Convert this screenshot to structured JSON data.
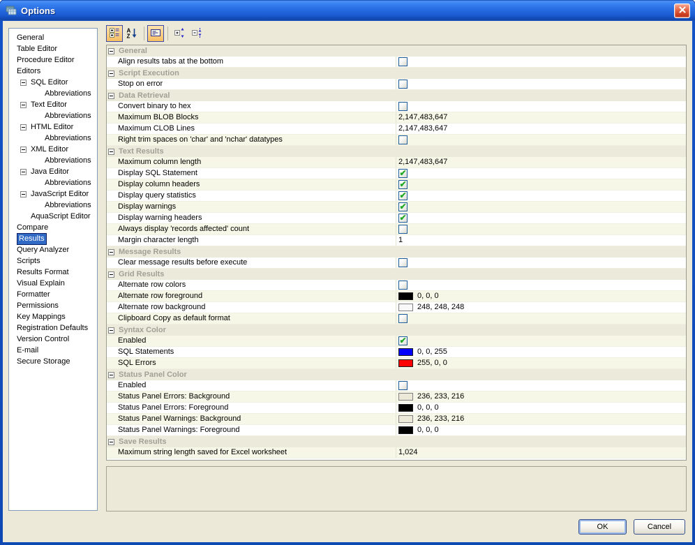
{
  "window": {
    "title": "Options"
  },
  "buttons": {
    "ok": "OK",
    "cancel": "Cancel"
  },
  "description_panel": {
    "text": ""
  },
  "colors": {
    "selection_blue": "#316ac5",
    "check_green": "#22a826",
    "pressed_toolbar_orange": "#f9bf62",
    "shaded_row": "#f7f7e7",
    "section_header_bg": "#eceadb",
    "dialog_bg": "#ece9d8"
  },
  "toolbar": {
    "buttons": [
      {
        "name": "categorized-view",
        "pressed": true
      },
      {
        "name": "alphabetical-sort",
        "pressed": false
      },
      {
        "name": "show-description",
        "pressed": true
      },
      {
        "name": "expand-all",
        "pressed": false
      },
      {
        "name": "collapse-all",
        "pressed": false
      }
    ],
    "separators_after": [
      1,
      2
    ]
  },
  "sidebar": {
    "items": [
      {
        "label": "General",
        "indent": 0,
        "toggle": false,
        "selected": false
      },
      {
        "label": "Table Editor",
        "indent": 0,
        "toggle": false,
        "selected": false
      },
      {
        "label": "Procedure Editor",
        "indent": 0,
        "toggle": false,
        "selected": false
      },
      {
        "label": "Editors",
        "indent": 0,
        "toggle": false,
        "selected": false
      },
      {
        "label": "SQL Editor",
        "indent": 1,
        "toggle": true,
        "selected": false
      },
      {
        "label": "Abbreviations",
        "indent": 2,
        "toggle": false,
        "selected": false
      },
      {
        "label": "Text Editor",
        "indent": 1,
        "toggle": true,
        "selected": false
      },
      {
        "label": "Abbreviations",
        "indent": 2,
        "toggle": false,
        "selected": false
      },
      {
        "label": "HTML Editor",
        "indent": 1,
        "toggle": true,
        "selected": false
      },
      {
        "label": "Abbreviations",
        "indent": 2,
        "toggle": false,
        "selected": false
      },
      {
        "label": "XML Editor",
        "indent": 1,
        "toggle": true,
        "selected": false
      },
      {
        "label": "Abbreviations",
        "indent": 2,
        "toggle": false,
        "selected": false
      },
      {
        "label": "Java Editor",
        "indent": 1,
        "toggle": true,
        "selected": false
      },
      {
        "label": "Abbreviations",
        "indent": 2,
        "toggle": false,
        "selected": false
      },
      {
        "label": "JavaScript Editor",
        "indent": 1,
        "toggle": true,
        "selected": false
      },
      {
        "label": "Abbreviations",
        "indent": 2,
        "toggle": false,
        "selected": false
      },
      {
        "label": "AquaScript Editor",
        "indent": 1,
        "toggle": false,
        "selected": false
      },
      {
        "label": "Compare",
        "indent": 0,
        "toggle": false,
        "selected": false
      },
      {
        "label": "Results",
        "indent": 0,
        "toggle": false,
        "selected": true
      },
      {
        "label": "Query Analyzer",
        "indent": 0,
        "toggle": false,
        "selected": false
      },
      {
        "label": "Scripts",
        "indent": 0,
        "toggle": false,
        "selected": false
      },
      {
        "label": "Results Format",
        "indent": 0,
        "toggle": false,
        "selected": false
      },
      {
        "label": "Visual Explain",
        "indent": 0,
        "toggle": false,
        "selected": false
      },
      {
        "label": "Formatter",
        "indent": 0,
        "toggle": false,
        "selected": false
      },
      {
        "label": "Permissions",
        "indent": 0,
        "toggle": false,
        "selected": false
      },
      {
        "label": "Key Mappings",
        "indent": 0,
        "toggle": false,
        "selected": false
      },
      {
        "label": "Registration Defaults",
        "indent": 0,
        "toggle": false,
        "selected": false
      },
      {
        "label": "Version Control",
        "indent": 0,
        "toggle": false,
        "selected": false
      },
      {
        "label": "E-mail",
        "indent": 0,
        "toggle": false,
        "selected": false
      },
      {
        "label": "Secure Storage",
        "indent": 0,
        "toggle": false,
        "selected": false
      }
    ]
  },
  "grid": {
    "sections": [
      {
        "title": "General",
        "rows": [
          {
            "label": "Align results tabs at the bottom",
            "shaded": false,
            "value": {
              "kind": "checkbox",
              "checked": false
            }
          }
        ]
      },
      {
        "title": "Script Execution",
        "rows": [
          {
            "label": "Stop on error",
            "shaded": false,
            "value": {
              "kind": "checkbox",
              "checked": false
            }
          }
        ]
      },
      {
        "title": "Data Retrieval",
        "rows": [
          {
            "label": "Convert binary to hex",
            "shaded": false,
            "value": {
              "kind": "checkbox",
              "checked": false
            }
          },
          {
            "label": "Maximum BLOB Blocks",
            "shaded": true,
            "value": {
              "kind": "text",
              "text": "2,147,483,647"
            }
          },
          {
            "label": "Maximum CLOB Lines",
            "shaded": false,
            "value": {
              "kind": "text",
              "text": "2,147,483,647"
            }
          },
          {
            "label": "Right trim spaces on 'char' and 'nchar' datatypes",
            "shaded": true,
            "value": {
              "kind": "checkbox",
              "checked": false
            }
          }
        ]
      },
      {
        "title": "Text Results",
        "rows": [
          {
            "label": "Maximum column length",
            "shaded": true,
            "value": {
              "kind": "text",
              "text": "2,147,483,647"
            }
          },
          {
            "label": "Display SQL Statement",
            "shaded": false,
            "value": {
              "kind": "checkbox",
              "checked": true
            }
          },
          {
            "label": "Display column headers",
            "shaded": true,
            "value": {
              "kind": "checkbox",
              "checked": true
            }
          },
          {
            "label": "Display query statistics",
            "shaded": false,
            "value": {
              "kind": "checkbox",
              "checked": true
            }
          },
          {
            "label": "Display warnings",
            "shaded": true,
            "value": {
              "kind": "checkbox",
              "checked": true
            }
          },
          {
            "label": "Display warning headers",
            "shaded": false,
            "value": {
              "kind": "checkbox",
              "checked": true
            }
          },
          {
            "label": "Always display 'records affected' count",
            "shaded": true,
            "value": {
              "kind": "checkbox",
              "checked": false
            }
          },
          {
            "label": "Margin character length",
            "shaded": false,
            "value": {
              "kind": "text",
              "text": "1"
            }
          }
        ]
      },
      {
        "title": "Message Results",
        "rows": [
          {
            "label": "Clear message results before execute",
            "shaded": false,
            "value": {
              "kind": "checkbox",
              "checked": false
            }
          }
        ]
      },
      {
        "title": "Grid Results",
        "rows": [
          {
            "label": "Alternate row colors",
            "shaded": false,
            "value": {
              "kind": "checkbox",
              "checked": false
            }
          },
          {
            "label": "Alternate row foreground",
            "shaded": true,
            "value": {
              "kind": "color",
              "hex": "#000000",
              "text": "0, 0, 0"
            }
          },
          {
            "label": "Alternate row background",
            "shaded": false,
            "value": {
              "kind": "color",
              "hex": "#f8f8f8",
              "text": "248, 248, 248"
            }
          },
          {
            "label": "Clipboard Copy as default format",
            "shaded": true,
            "value": {
              "kind": "checkbox",
              "checked": false
            }
          }
        ]
      },
      {
        "title": "Syntax Color",
        "rows": [
          {
            "label": "Enabled",
            "shaded": true,
            "value": {
              "kind": "checkbox",
              "checked": true
            }
          },
          {
            "label": "SQL Statements",
            "shaded": false,
            "value": {
              "kind": "color",
              "hex": "#0000ff",
              "text": "0, 0, 255"
            }
          },
          {
            "label": "SQL Errors",
            "shaded": true,
            "value": {
              "kind": "color",
              "hex": "#ff0000",
              "text": "255, 0, 0"
            }
          }
        ]
      },
      {
        "title": "Status Panel Color",
        "rows": [
          {
            "label": "Enabled",
            "shaded": false,
            "value": {
              "kind": "checkbox",
              "checked": false
            }
          },
          {
            "label": "Status Panel Errors: Background",
            "shaded": true,
            "value": {
              "kind": "color",
              "hex": "#ece9d8",
              "text": "236, 233, 216"
            }
          },
          {
            "label": "Status Panel Errors: Foreground",
            "shaded": false,
            "value": {
              "kind": "color",
              "hex": "#000000",
              "text": "0, 0, 0"
            }
          },
          {
            "label": "Status Panel Warnings: Background",
            "shaded": true,
            "value": {
              "kind": "color",
              "hex": "#ece9d8",
              "text": "236, 233, 216"
            }
          },
          {
            "label": "Status Panel Warnings: Foreground",
            "shaded": false,
            "value": {
              "kind": "color",
              "hex": "#000000",
              "text": "0, 0, 0"
            }
          }
        ]
      },
      {
        "title": "Save Results",
        "rows": [
          {
            "label": "Maximum string length saved for Excel worksheet",
            "shaded": true,
            "value": {
              "kind": "text",
              "text": "1,024"
            }
          }
        ]
      }
    ]
  }
}
